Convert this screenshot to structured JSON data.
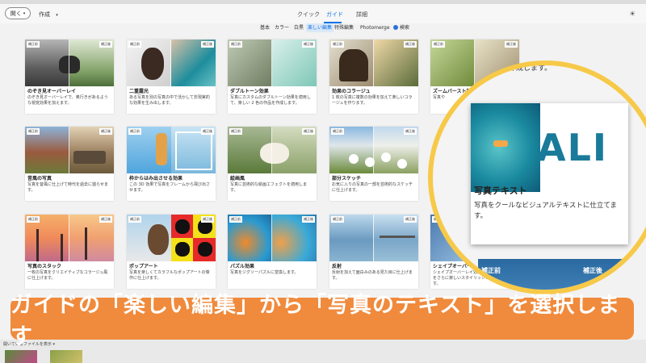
{
  "topbar": {
    "open_label": "開く",
    "create_label": "作成",
    "tabs": [
      {
        "label": "クイック",
        "active": false
      },
      {
        "label": "ガイド",
        "active": true
      },
      {
        "label": "詳細",
        "active": false
      }
    ]
  },
  "subtabs": [
    {
      "label": "基本",
      "active": false
    },
    {
      "label": "カラー",
      "active": false
    },
    {
      "label": "白黒",
      "active": false
    },
    {
      "label": "楽しい編集",
      "active": true
    },
    {
      "label": "特殊編集",
      "active": false
    },
    {
      "label": "Photomerge",
      "active": false
    },
    {
      "label": "検索",
      "active": false
    }
  ],
  "cards": [
    {
      "title": "のぞき見オーバーレイ",
      "desc": "のぞき見オーバーレイで、奥行きがあるような視覚効果を加えます。",
      "badge": "補正前",
      "badge2": "補正後"
    },
    {
      "title": "二重露光",
      "desc": "ある写真を別の写真の中で活かして非現実的な効果を生み出します。",
      "badge": "補正前",
      "badge2": "補正後"
    },
    {
      "title": "ダブルトーン効果",
      "desc": "写真にカスタムのダブルトーン効果を適用して、楽しい 2 色の作品を作成します。",
      "badge": "補正前",
      "badge2": "補正後"
    },
    {
      "title": "効果のコラージュ",
      "desc": "1 枚の写真に複数の効果を加えて楽しいコラージュを作ります。",
      "badge": "補正前",
      "badge2": "補正後"
    },
    {
      "title": "ズームバースト効果",
      "desc": "写真や",
      "badge": "補正前",
      "badge2": "補正後"
    },
    {
      "title": "昔風の写真",
      "desc": "写真を昔風に仕上げて時代を過去に遡らせます。",
      "badge": "補正前",
      "badge2": "補正後"
    },
    {
      "title": "枠からはみ出させる効果",
      "desc": "この 3D 効果で写真をフレームから飛び出させます。",
      "badge": "補正前",
      "badge2": "補正後"
    },
    {
      "title": "絵画風",
      "desc": "写真に芸術的な絵画エフェクトを適用します。",
      "badge": "補正前",
      "badge2": "補正後"
    },
    {
      "title": "部分スケッチ",
      "desc": "お気に入りの写真の一部を芸術的なスケッチに仕上げます。",
      "badge": "補正前",
      "badge2": "補正後"
    },
    {
      "title": "写真のスタック",
      "desc": "一枚の写真をクリエイティブなコラージュ風に仕上げます。",
      "badge": "補正前",
      "badge2": "補正後"
    },
    {
      "title": "ポップアート",
      "desc": "写真を楽しくてカラフルなポップアートの傑作に仕上げます。",
      "badge": "補正前",
      "badge2": "補正後"
    },
    {
      "title": "パズル効果",
      "desc": "写真をジグソーパズルに変換します。",
      "badge": "補正前",
      "badge2": "補正後"
    },
    {
      "title": "反射",
      "desc": "反射を加えて面白みのある見た目に仕上げます。",
      "badge": "補正前",
      "badge2": "補正後"
    },
    {
      "title": "シェイプオーバーレイ効果",
      "desc": "シェイプオーバーレイ効果を使用して、写真をさらに楽しいスタイリッシュなものにします。",
      "badge": "補正前",
      "badge2": "補正後"
    }
  ],
  "zoom": {
    "top_text": "を作成します。",
    "title": "写真テキスト",
    "desc": "写真をクールなビジュアルテキストに仕立てます。",
    "overlay_text": "ALI",
    "bottom_before": "補正前",
    "bottom_after": "補正後"
  },
  "banner": {
    "text": "ガイドの「楽しい編集」から「写真のテキスト」を選択します"
  },
  "footer": {
    "open_files_label": "開いているファイルを表示"
  },
  "colors": {
    "accent": "#1473e6",
    "banner": "#f08a3c",
    "zoom_ring": "#f7c948"
  }
}
